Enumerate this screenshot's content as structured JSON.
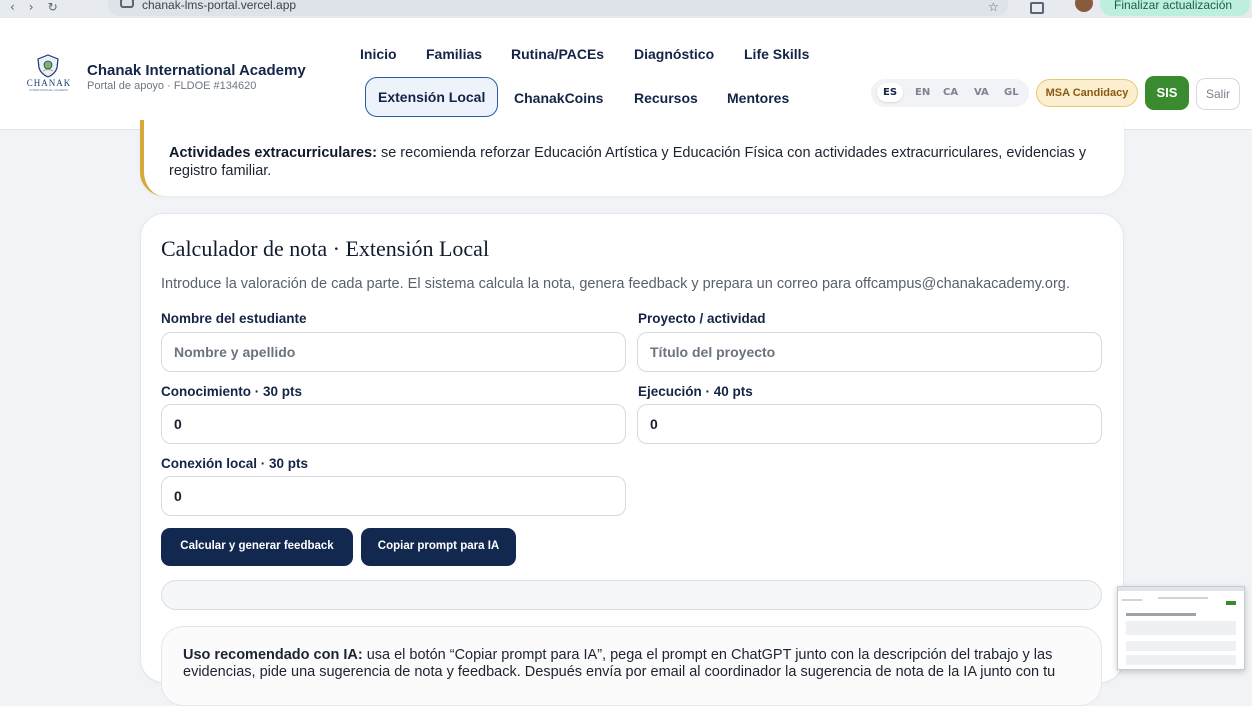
{
  "browser": {
    "url": "chanak-lms-portal.vercel.app",
    "update_label": "Finalizar actualización"
  },
  "header": {
    "logo_text": "CHANAK",
    "logo_subtext": "INTERNATIONAL ACADEMY",
    "brand_name": "Chanak International Academy",
    "brand_subtitle": "Portal de apoyo · FLDOE #134620",
    "nav_row1": [
      "Inicio",
      "Familias",
      "Rutina/PACEs",
      "Diagnóstico",
      "Life Skills"
    ],
    "nav_row2": [
      "Extensión Local",
      "ChanakCoins",
      "Recursos",
      "Mentores"
    ],
    "active_nav": "Extensión Local",
    "languages": [
      "ES",
      "EN",
      "CA",
      "VA",
      "GL"
    ],
    "selected_language": "ES",
    "badge": "MSA Candidacy",
    "sis_label": "SIS",
    "logout_label": "Salir"
  },
  "callout": {
    "bold": "Actividades extracurriculares:",
    "text": " se recomienda reforzar Educación Artística y Educación Física con actividades extracurriculares, evidencias y registro familiar."
  },
  "calculator": {
    "title": "Calculador de nota · Extensión Local",
    "description": "Introduce la valoración de cada parte. El sistema calcula la nota, genera feedback y prepara un correo para offcampus@chanakacademy.org.",
    "student_label": "Nombre del estudiante",
    "student_placeholder": "Nombre y apellido",
    "project_label": "Proyecto / actividad",
    "project_placeholder": "Título del proyecto",
    "knowledge_label": "Conocimiento · 30 pts",
    "knowledge_value": "0",
    "execution_label": "Ejecución · 40 pts",
    "execution_value": "0",
    "local_label": "Conexión local · 30 pts",
    "local_value": "0",
    "calc_button": "Calcular y generar feedback",
    "prompt_button": "Copiar prompt para IA",
    "result_text": ""
  },
  "ia_box": {
    "bold": "Uso recomendado con IA:",
    "text": " usa el botón “Copiar prompt para IA”, pega el prompt en ChatGPT junto con la descripción del trabajo y las evidencias, pide una sugerencia de nota y feedback. Después envía por email al coordinador la sugerencia de nota de la IA junto con tu"
  }
}
